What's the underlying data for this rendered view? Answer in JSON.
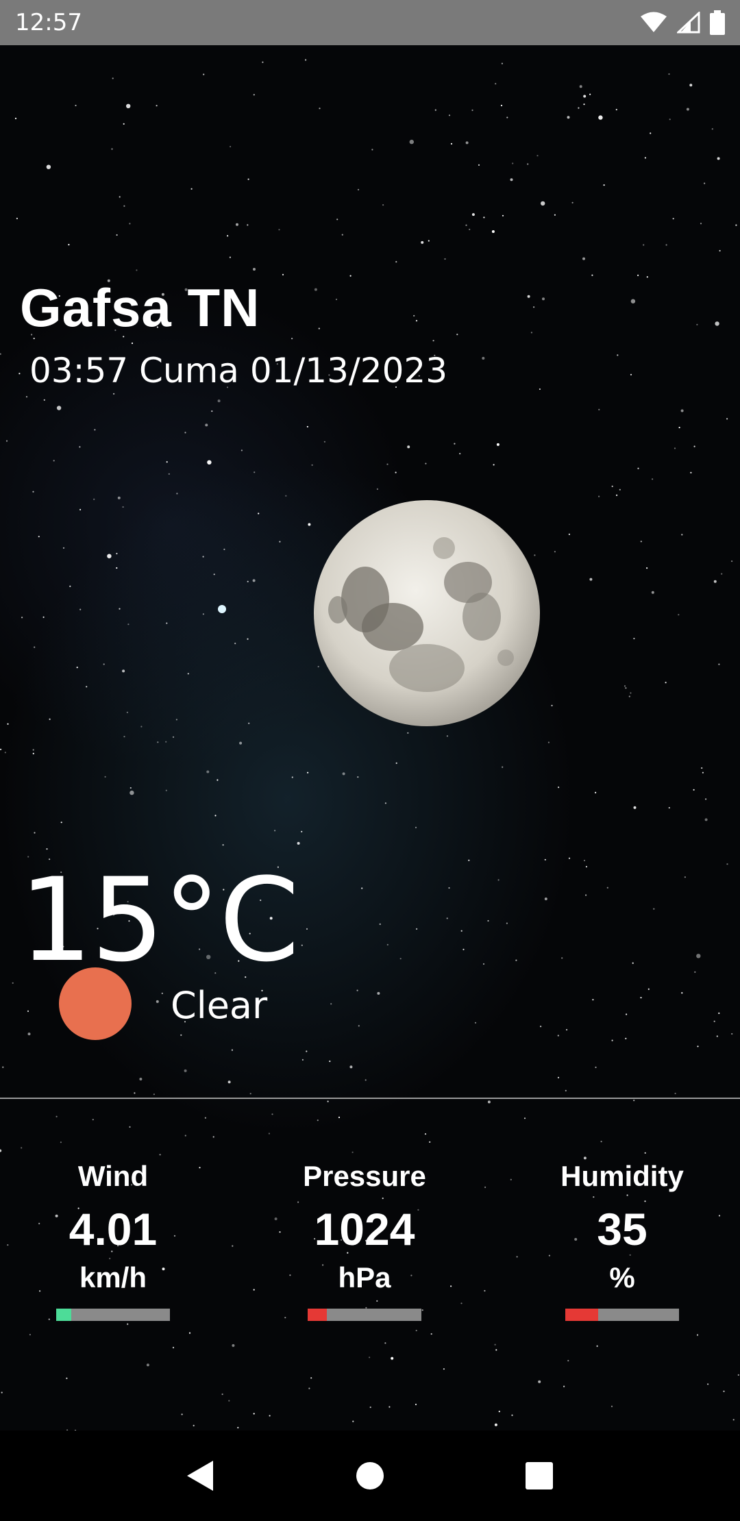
{
  "status_bar": {
    "time": "12:57",
    "icons": [
      "wifi-icon",
      "cellular-signal-icon",
      "battery-icon"
    ]
  },
  "location": {
    "city": "Gafsa TN",
    "datetime": "03:57 Cuma 01/13/2023"
  },
  "current": {
    "temperature": "15°C",
    "condition": "Clear",
    "condition_color": "#e8704f"
  },
  "stats": [
    {
      "label": "Wind",
      "value": "4.01",
      "unit": "km/h",
      "level": 0.13,
      "color": "#4ddc98"
    },
    {
      "label": "Pressure",
      "value": "1024",
      "unit": "hPa",
      "level": 0.17,
      "color": "#e53935"
    },
    {
      "label": "Humidity",
      "value": "35",
      "unit": "%",
      "level": 0.29,
      "color": "#e53935"
    }
  ],
  "nav_bar": {
    "buttons": [
      "back-icon",
      "home-icon",
      "recents-icon"
    ]
  }
}
